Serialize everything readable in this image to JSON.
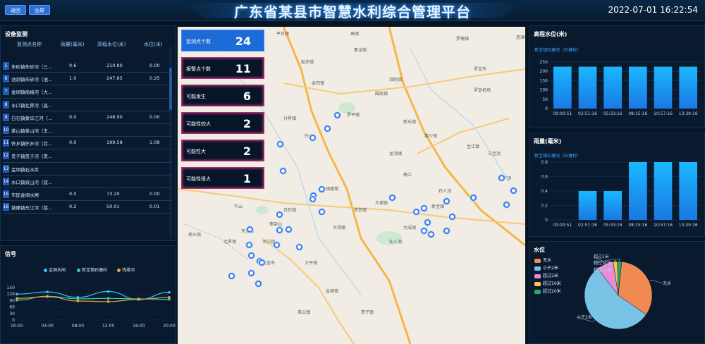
{
  "header": {
    "btn_back": "返回",
    "btn_full": "全屏",
    "title": "广东省某县市智慧水利综合管理平台",
    "datetime": "2022-07-01 16:22:54"
  },
  "device": {
    "title": "设备监测",
    "cols": [
      "监测点名称",
      "雨量(毫米)",
      "高程水位(米)",
      "水位(米)"
    ],
    "rows": [
      {
        "idx": "5",
        "name": "朱砂镇朱砂河（三…",
        "rain": "0.6",
        "elev": "210.80",
        "level": "0.00"
      },
      {
        "idx": "6",
        "name": "池洞镇朱砂河（池…",
        "rain": "1.0",
        "elev": "247.85",
        "level": "0.25"
      },
      {
        "idx": "7",
        "name": "金垌镇杨梅河（大…",
        "rain": "",
        "elev": "",
        "level": ""
      },
      {
        "idx": "8",
        "name": "水口镇北界河（高…",
        "rain": "",
        "elev": "",
        "level": ""
      },
      {
        "idx": "9",
        "name": "白石镇黄华江河（…",
        "rain": "0.0",
        "elev": "248.90",
        "level": "0.00"
      },
      {
        "idx": "10",
        "name": "茶山镇茶山河（丰…",
        "rain": "",
        "elev": "",
        "level": ""
      },
      {
        "idx": "11",
        "name": "怀乡镇怀乡河（月…",
        "rain": "0.0",
        "elev": "199.58",
        "level": "1.08"
      },
      {
        "idx": "12",
        "name": "贵子镇贵子河（贵…",
        "rain": "",
        "elev": "",
        "level": ""
      },
      {
        "idx": "13",
        "name": "金垌镇石水库",
        "rain": "",
        "elev": "",
        "level": ""
      },
      {
        "idx": "14",
        "name": "水口镇双山河（双…",
        "rain": "",
        "elev": "",
        "level": ""
      },
      {
        "idx": "15",
        "name": "市区金垌水闸",
        "rain": "0.0",
        "elev": "73.20",
        "level": "0.00"
      },
      {
        "idx": "16",
        "name": "镇隆镇东江河（荔…",
        "rain": "0.2",
        "elev": "50.01",
        "level": "0.01"
      }
    ]
  },
  "signal": {
    "title": "信号",
    "legend": [
      "金垌水闸",
      "新宝镇石塘村",
      "钱排河"
    ],
    "colors": [
      "#31c6ff",
      "#3fd1a0",
      "#f0a23b"
    ]
  },
  "cards": [
    {
      "label": "监测点个数",
      "value": "24"
    },
    {
      "label": "报警点个数",
      "value": "11"
    },
    {
      "label": "可能发生",
      "value": "6"
    },
    {
      "label": "可能性较大",
      "value": "2"
    },
    {
      "label": "可能性大",
      "value": "2"
    },
    {
      "label": "可能性很大",
      "value": "1"
    }
  ],
  "map_labels": [
    "平台镇",
    "高镇",
    "罗定市",
    "罗镜镇",
    "连滩镇",
    "素龙镇",
    "船步镇",
    "金鸡镇",
    "泗纶镇",
    "围底镇",
    "分界镇",
    "新乐镇",
    "罗平镇",
    "黎少镇",
    "生江镇",
    "龙湾镇",
    "罗定机场",
    "梅江",
    "镇隆镇",
    "思贺镇",
    "大湾镇",
    "大坡镇",
    "大成镇",
    "白石镇",
    "新宝镇",
    "石人顶",
    "牛山",
    "竹山",
    "笔架山",
    "天堂镇",
    "桥头镇",
    "北界镇",
    "水口镇",
    "大平镇",
    "仙人洞",
    "金垌镇",
    "茶山镇",
    "贵子镇",
    "信宜市",
    "梅子顶",
    "三宝顶"
  ],
  "chart_data": [
    {
      "type": "line",
      "title": "信号",
      "x": [
        "00:00",
        "04:00",
        "08:00",
        "12:00",
        "16:00",
        "20:00"
      ],
      "ylim": [
        0,
        150
      ],
      "yticks": [
        0,
        30,
        60,
        90,
        120,
        150
      ],
      "series": [
        {
          "name": "金垌水闸",
          "values": [
            120,
            130,
            105,
            132,
            95,
            128
          ]
        },
        {
          "name": "新宝镇石塘村",
          "values": [
            92,
            110,
            98,
            100,
            98,
            96
          ]
        },
        {
          "name": "钱排河",
          "values": [
            100,
            108,
            88,
            85,
            96,
            105
          ]
        }
      ],
      "grid": true,
      "legend": "top"
    },
    {
      "type": "bar",
      "title": "高程水位(米)",
      "subtitle": "新宝镇石塘河（石塘村）",
      "categories": [
        "00:00:51",
        "02:51:16",
        "05:33:16",
        "08:15:16",
        "10:57:16",
        "13:39:16"
      ],
      "values": [
        225,
        225,
        225,
        225,
        225,
        225
      ],
      "ylim": [
        0,
        250
      ],
      "yticks": [
        0,
        50,
        100,
        150,
        200,
        250
      ]
    },
    {
      "type": "bar",
      "title": "雨量(毫米)",
      "subtitle": "新宝镇石塘河（石塘村）",
      "categories": [
        "00:00:51",
        "02:51:16",
        "05:33:16",
        "08:15:16",
        "10:57:16",
        "13:39:16"
      ],
      "values": [
        0,
        0.4,
        0.4,
        0.8,
        0.8,
        0.8
      ],
      "ylim": [
        0,
        0.8
      ],
      "yticks": [
        0,
        0.2,
        0.4,
        0.6,
        0.8
      ]
    },
    {
      "type": "pie",
      "title": "水位",
      "legend": [
        "无水",
        "小于2米",
        "超过2米",
        "超过10米",
        "超过20米"
      ],
      "slice_labels": [
        "无水",
        "小于2米",
        "超过2米",
        "超过10米",
        "超过20米"
      ],
      "values": [
        33,
        55,
        8,
        2,
        2
      ],
      "colors": [
        "#f08a52",
        "#78c3e6",
        "#e88ad4",
        "#f2c94c",
        "#2aa86a"
      ]
    }
  ]
}
